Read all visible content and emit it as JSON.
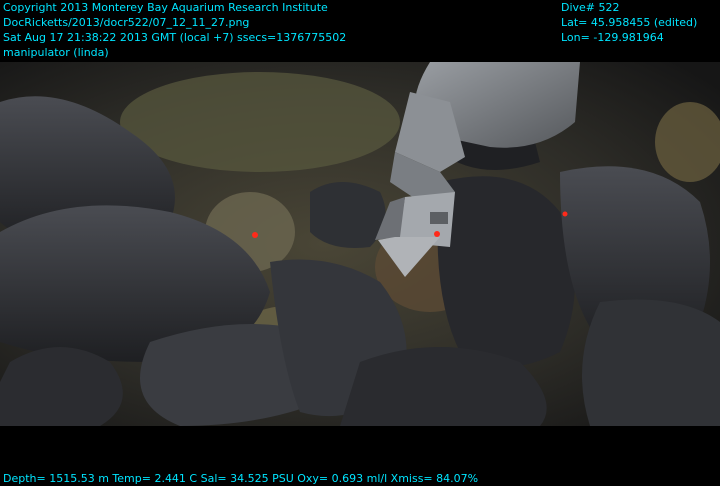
{
  "header": {
    "copyright": "Copyright 2013 Monterey Bay Aquarium Research Institute",
    "file_path": "DocRicketts/2013/docr522/07_12_11_27.png",
    "timestamp": "Sat Aug 17 21:38:22 2013 GMT (local +7)  ssecs=1376775502",
    "camera": "manipulator (linda)"
  },
  "dive_info": {
    "dive": "Dive# 522",
    "lat": "Lat= 45.958455 (edited)",
    "lon": "Lon= -129.981964"
  },
  "telemetry": {
    "line": "Depth= 1515.53 m  Temp= 2.441 C  Sal= 34.525 PSU  Oxy= 0.693 ml/l  Xmiss= 84.07%"
  },
  "colors": {
    "overlay_text": "#00e5ff",
    "laser": "#ff2a1a"
  }
}
